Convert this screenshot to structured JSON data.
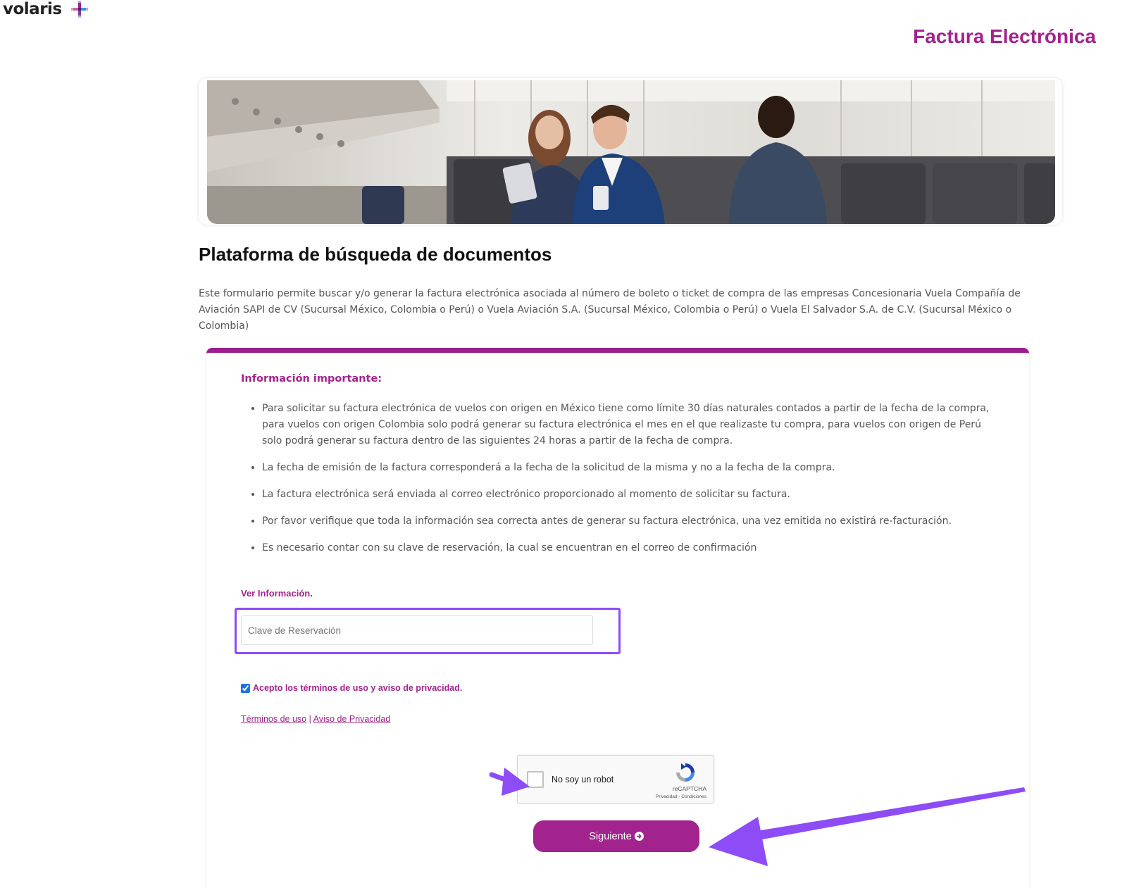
{
  "brand": {
    "logo_text": "volaris"
  },
  "header": {
    "title": "Factura Electrónica"
  },
  "main": {
    "title": "Plataforma de búsqueda de documentos",
    "intro": "Este formulario permite buscar y/o generar la factura electrónica asociada al número de boleto o ticket de compra de las empresas Concesionaria Vuela Compañía de Aviación SAPI de CV (Sucursal México, Colombia o Perú) o Vuela Aviación S.A. (Sucursal México, Colombia o Perú) o Vuela El Salvador S.A. de C.V. (Sucursal México o Colombia)"
  },
  "info": {
    "title": "Información importante:",
    "items": [
      "Para solicitar su factura electrónica de vuelos con origen en México tiene como límite 30 días naturales contados a partir de la fecha de la compra, para vuelos con origen Colombia solo podrá generar su factura electrónica el mes en el que realizaste tu compra, para vuelos con origen de Perú solo podrá generar su factura dentro de las siguientes 24 horas a partir de la fecha de compra.",
      "La fecha de emisión de la factura corresponderá a la fecha de la solicitud de la misma y no a la fecha de la compra.",
      "La factura electrónica será enviada al correo electrónico proporcionado al momento de solicitar su factura.",
      "Por favor verifique que toda la información sea correcta antes de generar su factura electrónica, una vez emitida no existirá re-facturación.",
      "Es necesario contar con su clave de reservación, la cual se encuentran en el correo de confirmación"
    ]
  },
  "form": {
    "section_label": "Ver Información.",
    "reservation_placeholder": "Clave de Reservación",
    "reservation_value": "",
    "terms_label": "Acepto los términos de uso y aviso de privacidad.",
    "terms_checked": true,
    "terms_link": "Términos de uso",
    "separator": "|",
    "privacy_link": "Aviso de Privacidad"
  },
  "captcha": {
    "label": "No soy un robot",
    "brand": "reCAPTCHA",
    "legal": "Privacidad - Condiciones",
    "checked": false
  },
  "actions": {
    "next_label": "Siguiente"
  },
  "colors": {
    "brand": "#a2238d",
    "card_border": "#9a1f8b",
    "annotation": "#8d4cf6",
    "text": "#555555"
  },
  "icons": [
    "volaris-plus-icon",
    "recaptcha-icon",
    "arrow-circle-right-icon",
    "annotation-arrow-icon"
  ]
}
